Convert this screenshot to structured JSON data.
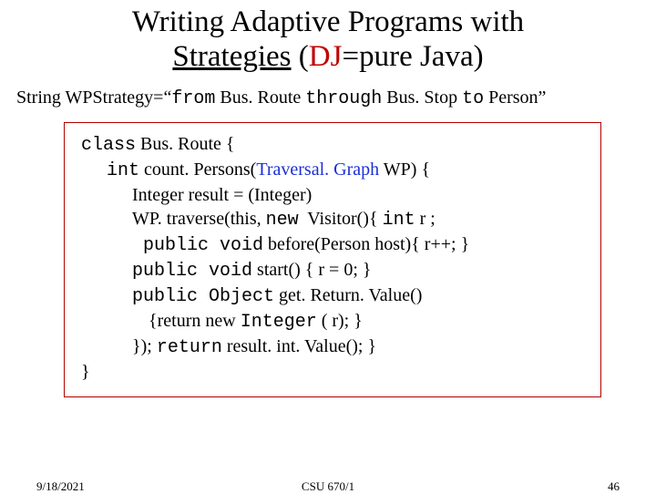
{
  "title": {
    "line1": "Writing Adaptive Programs with",
    "line2_prefix": "Strategies",
    "line2_paren_open": " (",
    "line2_dj": "DJ",
    "line2_rest": "=pure Java)"
  },
  "strategy_line": {
    "p1": "String WPStrategy=“",
    "p2_mono": "from",
    "p3": " Bus. Route ",
    "p4_mono": "through",
    "p5": " Bus. Stop ",
    "p6_mono": "to",
    "p7": " Person”"
  },
  "code": {
    "l1a": "class",
    "l1b": " Bus. Route {",
    "l2a": "int",
    "l2b": " count. Persons(",
    "l2c": "Traversal. Graph",
    "l2d": " WP) {",
    "l3": "Integer result = (Integer)",
    "l4a": "WP. traverse(this, ",
    "l4b": "new",
    "l4c": "  Visitor(){ ",
    "l4d": "int",
    "l4e": " r ;",
    "l5a": " public void",
    "l5b": " before(Person host){ r++; }",
    "l6a": "public void",
    "l6b": " start() { r = 0; }",
    "l7a": "public Object",
    "l7b": " get. Return. Value()",
    "l8a": "{return new ",
    "l8b": "Integer",
    "l8c": " ( r); }",
    "l9a": "}); ",
    "l9b": "return",
    "l9c": " result. int. Value(); }",
    "l10": "}"
  },
  "footer": {
    "date": "9/18/2021",
    "course": "CSU 670/1",
    "page": "46"
  }
}
